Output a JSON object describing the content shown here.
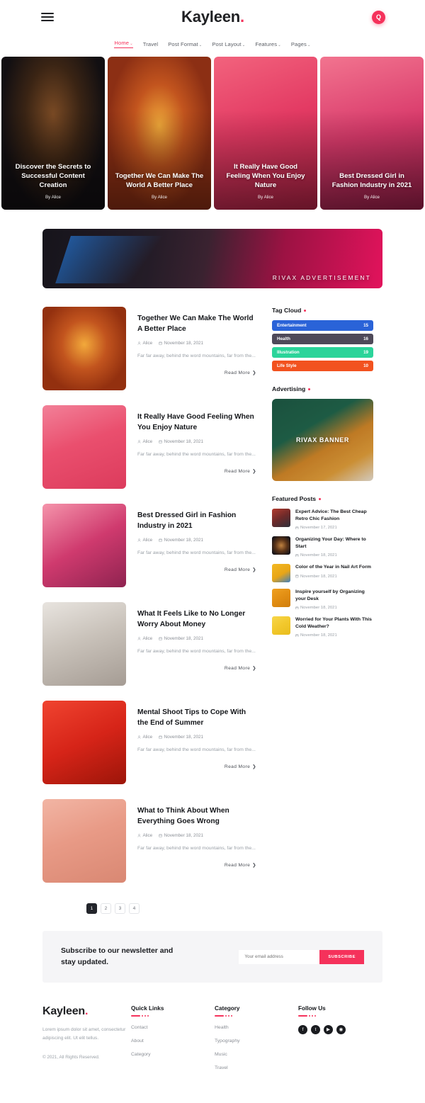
{
  "header": {
    "brand": "Kayleen",
    "brand_dot": ".",
    "menu_icon": "hamburger-icon",
    "search_icon": "Q",
    "accent_color": "#f5325b",
    "nav": [
      {
        "label": "Home",
        "caret": "⌄",
        "active": true
      },
      {
        "label": "Travel",
        "caret": "",
        "active": false
      },
      {
        "label": "Post Format",
        "caret": "⌄",
        "active": false
      },
      {
        "label": "Post Layout",
        "caret": "⌄",
        "active": false
      },
      {
        "label": "Features",
        "caret": "⌄",
        "active": false
      },
      {
        "label": "Pages",
        "caret": "⌄",
        "active": false
      }
    ]
  },
  "hero": [
    {
      "title": "Discover the Secrets to Successful Content Creation",
      "by": "By  Alice"
    },
    {
      "title": "Together We Can Make The World A Better Place",
      "by": "By  Alice"
    },
    {
      "title": "It Really Have Good Feeling When You Enjoy Nature",
      "by": "By  Alice"
    },
    {
      "title": "Best Dressed Girl in Fashion Industry in 2021",
      "by": "By  Alice"
    }
  ],
  "ad_banner": {
    "text": "RIVAX ADVERTISEMENT"
  },
  "posts": [
    {
      "title": "Together We Can Make The World A Better Place",
      "author": "Alice",
      "date": "November 18, 2021",
      "excerpt": "Far far away, behind the word mountains, far from the...",
      "read_more": "Read More",
      "arrow": "❯"
    },
    {
      "title": "It Really Have Good Feeling When You Enjoy Nature",
      "author": "Alice",
      "date": "November 18, 2021",
      "excerpt": "Far far away, behind the word mountains, far from the...",
      "read_more": "Read More",
      "arrow": "❯"
    },
    {
      "title": "Best Dressed Girl in Fashion Industry in 2021",
      "author": "Alice",
      "date": "November 18, 2021",
      "excerpt": "Far far away, behind the word mountains, far from the...",
      "read_more": "Read More",
      "arrow": "❯"
    },
    {
      "title": "What It Feels Like to No Longer Worry About Money",
      "author": "Alice",
      "date": "November 18, 2021",
      "excerpt": "Far far away, behind the word mountains, far from the...",
      "read_more": "Read More",
      "arrow": "❯"
    },
    {
      "title": "Mental Shoot Tips to Cope With the End of Summer",
      "author": "Alice",
      "date": "November 18, 2021",
      "excerpt": "Far far away, behind the word mountains, far from the...",
      "read_more": "Read More",
      "arrow": "❯"
    },
    {
      "title": "What to Think About When Everything Goes Wrong",
      "author": "Alice",
      "date": "November 18, 2021",
      "excerpt": "Far far away, behind the word mountains, far from the...",
      "read_more": "Read More",
      "arrow": "❯"
    }
  ],
  "sidebar": {
    "tag_cloud": {
      "title": "Tag Cloud",
      "tags": [
        {
          "label": "Entertainment",
          "count": "15",
          "color": "#2a63d8"
        },
        {
          "label": "Health",
          "count": "16",
          "color": "#4e4959"
        },
        {
          "label": "Illustration",
          "count": "19",
          "color": "#2bd49a"
        },
        {
          "label": "Life Style",
          "count": "10",
          "color": "#f2521f"
        }
      ]
    },
    "advertising": {
      "title": "Advertising",
      "banner_text": "RIVAX BANNER"
    },
    "featured": {
      "title": "Featured Posts",
      "items": [
        {
          "title": "Expert Advice: The Best Cheap Retro Chic Fashion",
          "date": "November 17, 2021"
        },
        {
          "title": "Organizing Your Day: Where to Start",
          "date": "November 18, 2021"
        },
        {
          "title": "Color of the Year in Nail Art Form",
          "date": "November 18, 2021"
        },
        {
          "title": "Inspire yourself by Organizing your Desk",
          "date": "November 18, 2021"
        },
        {
          "title": "Worried for Your Plants With This Cold Weather?",
          "date": "November 18, 2021"
        }
      ]
    }
  },
  "pagination": [
    {
      "label": "1",
      "active": true
    },
    {
      "label": "2",
      "active": false
    },
    {
      "label": "3",
      "active": false
    },
    {
      "label": "4",
      "active": false
    }
  ],
  "newsletter": {
    "heading": "Subscribe to our newsletter and stay updated.",
    "placeholder": "Your email address",
    "button": "SUBSCRIBE"
  },
  "footer": {
    "brand": "Kayleen",
    "brand_dot": ".",
    "description": "Lorem ipsum dolor sit amet, consectetur adipiscing elit. Ut elit tellus.",
    "copyright": "© 2021, All Rights Reserved.",
    "quick_links": {
      "title": "Quick Links",
      "items": [
        "Contact",
        "About",
        "Category"
      ]
    },
    "category": {
      "title": "Category",
      "items": [
        "Health",
        "Typography",
        "Music",
        "Travel"
      ]
    },
    "follow": {
      "title": "Follow Us",
      "socials": [
        {
          "name": "facebook-icon",
          "glyph": "f"
        },
        {
          "name": "twitter-icon",
          "glyph": "t"
        },
        {
          "name": "youtube-icon",
          "glyph": "▶"
        },
        {
          "name": "instagram-icon",
          "glyph": "◉"
        }
      ]
    }
  },
  "icons": {
    "user": "👤",
    "calendar": "📅"
  }
}
